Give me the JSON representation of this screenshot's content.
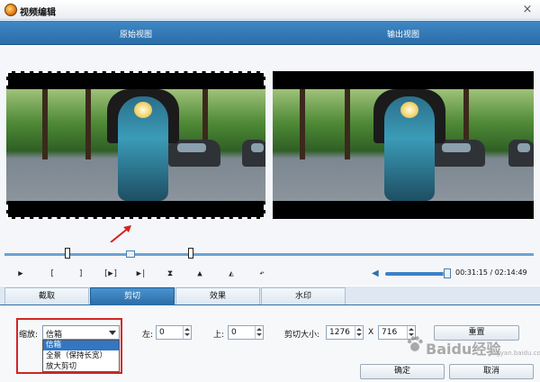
{
  "window": {
    "title": "视频编辑",
    "close_glyph": "×"
  },
  "views": {
    "original_label": "原始视图",
    "output_label": "输出视图"
  },
  "toolbar": {
    "play": "▶",
    "mark_in": "[",
    "mark_out": "]",
    "play_range": "[▶]",
    "prev_frame": "▶|",
    "split": "⧗",
    "flip_v": "▲",
    "flip_h": "◭",
    "undo": "↶"
  },
  "playback": {
    "time": "00:31:15 / 02:14:49",
    "volume_level": 0.92,
    "progress": 0.24
  },
  "tabs": [
    {
      "label": "截取",
      "active": false
    },
    {
      "label": "剪切",
      "active": true
    },
    {
      "label": "效果",
      "active": false
    },
    {
      "label": "水印",
      "active": false
    }
  ],
  "settings": {
    "zoom_label": "缩放:",
    "zoom_value": "信箱",
    "zoom_options": [
      "信箱",
      "全景（保持长宽）",
      "放大剪切"
    ],
    "left_label": "左:",
    "left_value": "0",
    "top_label": "上:",
    "top_value": "0",
    "crop_size_label": "剪切大小:",
    "crop_width": "1276",
    "crop_x": "X",
    "crop_height": "716",
    "reset_label": "重置"
  },
  "buttons": {
    "ok": "确定",
    "cancel": "取消"
  },
  "watermark": {
    "text": "Baidu经验",
    "sub": "jingyan.baidu.com"
  },
  "colors": {
    "header_blue": "#2b6ea8",
    "highlight_red": "#d32424",
    "selection_blue": "#3276c4"
  }
}
